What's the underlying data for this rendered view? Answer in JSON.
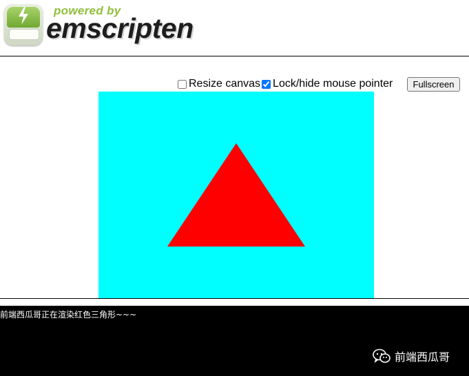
{
  "logo": {
    "powered_by": "powered by",
    "brand": "emscripten",
    "icon": "emscripten-logo-icon"
  },
  "controls": {
    "resize_canvas_label": "Resize canvas",
    "resize_canvas_checked": false,
    "lock_pointer_label": "Lock/hide mouse pointer",
    "lock_pointer_checked": true,
    "fullscreen_label": "Fullscreen"
  },
  "canvas": {
    "background_color": "#00ffff",
    "shape": "triangle",
    "shape_color": "#ff0000"
  },
  "console": {
    "output_line": "前端西瓜哥正在渲染红色三角形~~~",
    "background_color": "#000000",
    "text_color": "#ffffff"
  },
  "watermark": {
    "icon": "wechat-icon",
    "text": "前端西瓜哥"
  }
}
